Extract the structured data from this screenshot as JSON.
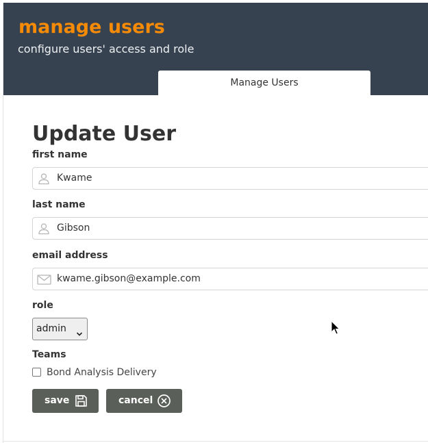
{
  "header": {
    "title": "manage users",
    "subtitle": "configure users' access and role",
    "tab_label": "Manage Users"
  },
  "form": {
    "title": "Update User",
    "first_name": {
      "label": "first name",
      "value": "Kwame",
      "icon": "user-icon"
    },
    "last_name": {
      "label": "last name",
      "value": "Gibson",
      "icon": "user-icon"
    },
    "email": {
      "label": "email address",
      "value": "kwame.gibson@example.com",
      "icon": "envelope-icon"
    },
    "role": {
      "label": "role",
      "selected": "admin"
    },
    "teams": {
      "label": "Teams",
      "options": [
        {
          "label": "Bond Analysis Delivery",
          "checked": false
        }
      ]
    },
    "save_label": "save",
    "cancel_label": "cancel"
  },
  "colors": {
    "header_bg": "#36424f",
    "accent": "#f58a07",
    "button_bg": "#5b5f59"
  }
}
